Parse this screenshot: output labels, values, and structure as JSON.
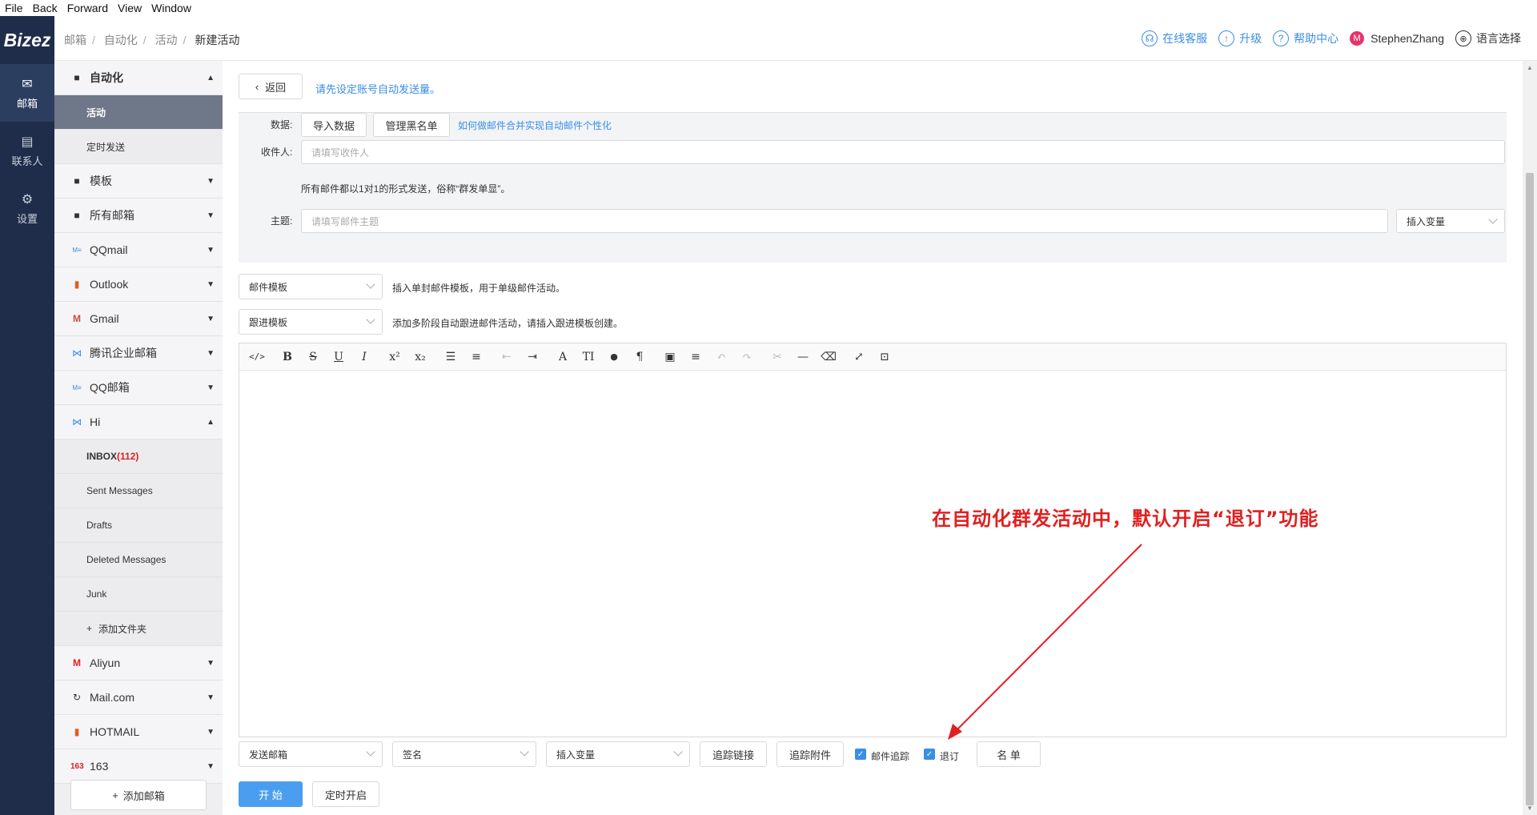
{
  "menubar": [
    "File",
    "Back",
    "Forward",
    "View",
    "Window"
  ],
  "leftnav": {
    "logo": "Bizez",
    "items": [
      {
        "label": "邮箱",
        "icon": "mail-icon"
      },
      {
        "label": "联系人",
        "icon": "contacts-icon"
      },
      {
        "label": "设置",
        "icon": "gear-icon"
      }
    ]
  },
  "breadcrumb": [
    "邮箱",
    "自动化",
    "活动",
    "新建活动"
  ],
  "topright": {
    "support": "在线客服",
    "upgrade": "升级",
    "help": "帮助中心",
    "avatar_letter": "M",
    "username": "StephenZhang",
    "language": "语言选择"
  },
  "sidebar": {
    "automation": "自动化",
    "activity": "活动",
    "scheduled": "定时发送",
    "template": "模板",
    "allmail": "所有邮箱",
    "qqmail": "QQmail",
    "outlook": "Outlook",
    "gmail": "Gmail",
    "tencent": "腾讯企业邮箱",
    "qqmailbox": "QQ邮箱",
    "hi": "Hi",
    "inbox": "INBOX",
    "inbox_count": "(112)",
    "sent": "Sent Messages",
    "drafts": "Drafts",
    "deleted": "Deleted Messages",
    "junk": "Junk",
    "add_folder": "添加文件夹",
    "aliyun": "Aliyun",
    "mailcom": "Mail.com",
    "hotmail": "HOTMAIL",
    "n163": "163",
    "add_mailbox": "添加邮箱"
  },
  "main": {
    "back": "返回",
    "notice": "请先设定账号自动发送量。",
    "data_label": "数据:",
    "import_data": "导入数据",
    "manage_blacklist": "管理黑名单",
    "merge_link": "如何做邮件合并实现自动邮件个性化",
    "recipient_label": "收件人:",
    "recipient_placeholder": "请填写收件人",
    "send_note": "所有邮件都以1对1的形式发送，俗称“群发单显”。",
    "subject_label": "主题:",
    "subject_placeholder": "请填写邮件主题",
    "insert_var": "插入变量",
    "mail_template": "邮件模板",
    "mail_template_hint": "插入单封邮件模板，用于单级邮件活动。",
    "followup_template": "跟进模板",
    "followup_hint": "添加多阶段自动跟进邮件活动，请插入跟进模板创建。",
    "annotation": "在自动化群发活动中，默认开启“退订”功能",
    "send_mailbox": "发送邮箱",
    "signature": "签名",
    "insert_var2": "插入变量",
    "track_link": "追踪链接",
    "track_attach": "追踪附件",
    "mail_track": "邮件追踪",
    "unsubscribe": "退订",
    "list": "名 单",
    "start": "开 始",
    "schedule": "定时开启"
  },
  "toolbar": {
    "code": "</>",
    "bold": "B",
    "strike": "S",
    "underline": "U",
    "italic": "I",
    "sup": "x²",
    "sub": "x₂",
    "ul": "☰",
    "ol": "≡",
    "outdent": "⇤",
    "indent": "⇥",
    "font": "A",
    "size": "TI",
    "color": "●",
    "para": "¶",
    "image": "▣",
    "align": "≡",
    "undo": "↶",
    "redo": "↷",
    "cut": "✂",
    "hr": "—",
    "eraser": "⌫",
    "fullscreen": "⤢",
    "select": "⊡"
  }
}
